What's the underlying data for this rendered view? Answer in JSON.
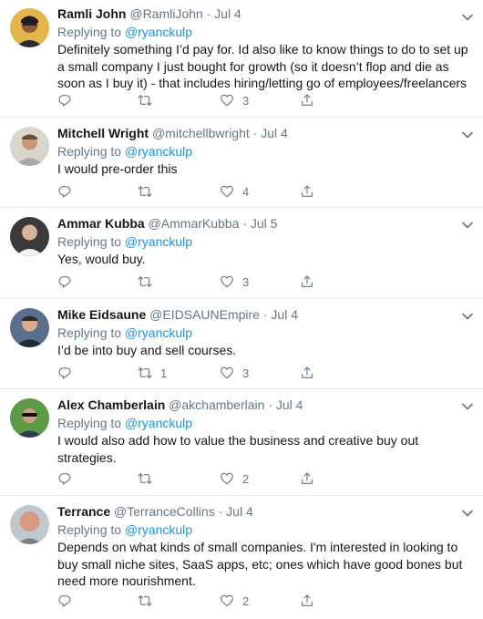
{
  "replying_label": "Replying to",
  "tweets": [
    {
      "name": "Ramli John",
      "handle": "@RamliJohn",
      "date": "Jul 4",
      "replying_to": "@ryanckulp",
      "text_lines": [
        "Definitely something I’d pay for. Id also like to know things to do to set up",
        "a small company I just bought for growth (so it doesn’t flop and die as",
        "soon as I buy it) - that includes hiring/letting go of employees/freelancers"
      ],
      "replies": "",
      "retweets": "",
      "likes": "3"
    },
    {
      "name": "Mitchell Wright",
      "handle": "@mitchellbwright",
      "date": "Jul 4",
      "replying_to": "@ryanckulp",
      "text_lines": [
        "I would pre-order this"
      ],
      "replies": "",
      "retweets": "",
      "likes": "4"
    },
    {
      "name": "Ammar Kubba",
      "handle": "@AmmarKubba",
      "date": "Jul 5",
      "replying_to": "@ryanckulp",
      "text_lines": [
        "Yes, would buy."
      ],
      "replies": "",
      "retweets": "",
      "likes": "3"
    },
    {
      "name": "Mike Eidsaune",
      "handle": "@EIDSAUNEmpire",
      "date": "Jul 4",
      "replying_to": "@ryanckulp",
      "text_lines": [
        "I’d be into buy and sell courses."
      ],
      "replies": "",
      "retweets": "1",
      "likes": "3"
    },
    {
      "name": "Alex Chamberlain",
      "handle": "@akchamberlain",
      "date": "Jul 4",
      "replying_to": "@ryanckulp",
      "text_lines": [
        "I would also add how to value the business and creative buy out",
        "strategies."
      ],
      "replies": "",
      "retweets": "",
      "likes": "2"
    },
    {
      "name": "Terrance",
      "handle": "@TerranceCollins",
      "date": "Jul 4",
      "replying_to": "@ryanckulp",
      "text_lines": [
        "Depends on what kinds of small companies. I'm interested in looking to",
        "buy small niche sites, SaaS apps, etc; ones which have good bones but",
        "need more nourishment."
      ],
      "replies": "",
      "retweets": "",
      "likes": "2"
    }
  ],
  "icons": {
    "reply": "reply-icon",
    "retweet": "retweet-icon",
    "like": "heart-icon",
    "share": "share-icon",
    "more": "chevron-down-icon"
  },
  "colors": {
    "text": "#14171a",
    "secondary": "#657786",
    "link": "#1b95e0",
    "divider": "#e6ecf0"
  }
}
